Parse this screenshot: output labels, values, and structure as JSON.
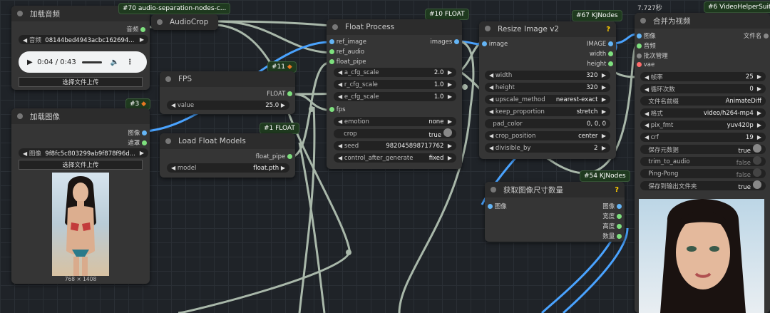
{
  "nodes": {
    "load_audio": {
      "title": "加载音频",
      "out_audio": "音频",
      "audio_label": "音频",
      "audio_file": "08144bed4943acbc162694...",
      "time": "0:04 / 0:43",
      "upload": "选择文件上传"
    },
    "audio_sep": {
      "badge": "#70 audio-separation-nodes-c...",
      "title": "AudioCrop"
    },
    "fps": {
      "title": "FPS",
      "out": "FLOAT",
      "w_label": "value",
      "w_value": "25.0",
      "badge": "#11"
    },
    "load_image": {
      "badge": "#3",
      "title": "加载图像",
      "out_image": "图像",
      "out_mask": "遮罩",
      "img_label": "图像",
      "img_file": "9f8fc5c803299ab9f878f96d...",
      "upload": "选择文件上传",
      "dims": "768 × 1408"
    },
    "load_float_models": {
      "badge": "#1 FLOAT",
      "title": "Load Float Models",
      "out": "float_pipe",
      "w_label": "model",
      "w_value": "float.pth"
    },
    "float_process": {
      "badge": "#10 FLOAT",
      "title": "Float Process",
      "inputs": [
        "ref_image",
        "ref_audio",
        "float_pipe"
      ],
      "output": "images",
      "widgets": [
        {
          "label": "a_cfg_scale",
          "value": "2.0"
        },
        {
          "label": "r_cfg_scale",
          "value": "1.0"
        },
        {
          "label": "e_cfg_scale",
          "value": "1.0"
        }
      ],
      "fps_input": "fps",
      "widgets2": [
        {
          "label": "emotion",
          "value": "none"
        },
        {
          "label": "crop",
          "value": "true"
        },
        {
          "label": "seed",
          "value": "982045898717762"
        },
        {
          "label": "control_after_generate",
          "value": "fixed"
        }
      ]
    },
    "resize": {
      "badge": "#67 KJNodes",
      "title": "Resize Image v2",
      "input": "image",
      "outputs": [
        "IMAGE",
        "width",
        "height"
      ],
      "widgets": [
        {
          "label": "width",
          "value": "320"
        },
        {
          "label": "height",
          "value": "320"
        },
        {
          "label": "upscale_method",
          "value": "nearest-exact"
        },
        {
          "label": "keep_proportion",
          "value": "stretch"
        },
        {
          "label": "pad_color",
          "value": "0, 0, 0"
        },
        {
          "label": "crop_position",
          "value": "center"
        },
        {
          "label": "divisible_by",
          "value": "2"
        }
      ]
    },
    "get_size": {
      "badge": "#54 KJNodes",
      "title": "获取图像尺寸数量",
      "input": "图像",
      "outputs": [
        "图像",
        "宽度",
        "高度",
        "数量"
      ]
    },
    "video_combine": {
      "time": "7.727秒",
      "badge": "#6 VideoHelperSuite",
      "title": "合并为视频",
      "inputs": [
        "图像",
        "音频",
        "批次管理",
        "vae"
      ],
      "out": "文件名",
      "widgets": [
        {
          "label": "帧率",
          "value": "25"
        },
        {
          "label": "循环次数",
          "value": "0"
        },
        {
          "label": "文件名前缀",
          "value": "AnimateDiff"
        },
        {
          "label": "格式",
          "value": "video/h264-mp4"
        },
        {
          "label": "pix_fmt",
          "value": "yuv420p"
        },
        {
          "label": "crf",
          "value": "19"
        },
        {
          "label": "保存元数据",
          "value": "true"
        },
        {
          "label": "trim_to_audio",
          "value": "false"
        },
        {
          "label": "Ping-Pong",
          "value": "false"
        },
        {
          "label": "保存到输出文件夹",
          "value": "true"
        }
      ]
    }
  },
  "colors": {
    "image_slot": "#64b5f6",
    "float_slot": "#7ee07e",
    "audio_slot": "#7ee07e",
    "vae_slot": "#ff6b6b",
    "wire_blue": "#4aa3ff",
    "wire_green": "#9fb5a0"
  }
}
